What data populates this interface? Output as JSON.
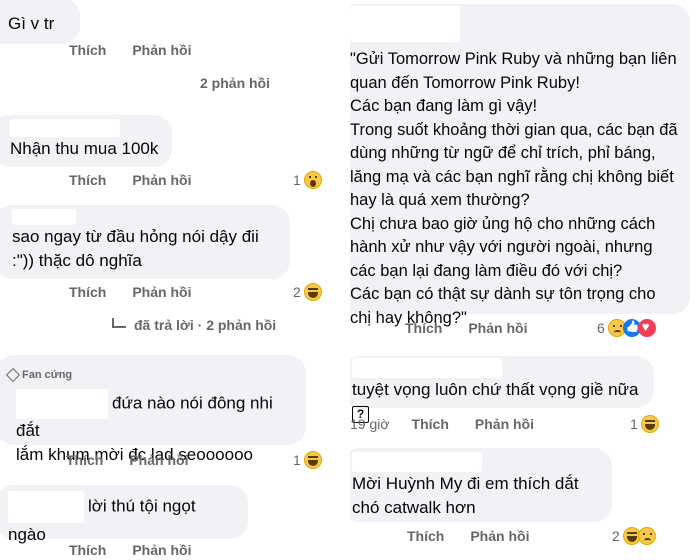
{
  "actions": {
    "like": "Thích",
    "reply": "Phản hồi"
  },
  "left": {
    "c1": {
      "text": "Gì v tr",
      "replies": "2 phản hồi"
    },
    "c2": {
      "text": "Nhận thu mua 100k",
      "react_count": "1"
    },
    "c3": {
      "text": "sao ngay từ đầu hỏng nói dậy đii :\")) thặc dô nghĩa",
      "react_count": "2",
      "replies": "đã trả lời · 2 phản hồi"
    },
    "c4": {
      "badge": "Fan cứng",
      "text_line1": "đứa nào nói đông nhi đắt",
      "text_line2": "lắm khum mời đc lad seoooooo",
      "react_count": "1"
    },
    "c5": {
      "text": "lời thú tội ngọt ngào"
    }
  },
  "right": {
    "c1": {
      "text": "\"Gửi Tomorrow Pink Ruby và những bạn liên quan đến Tomorrow Pink Ruby!\nCác bạn đang làm gì vậy!\nTrong suốt khoảng thời gian qua, các bạn đã dùng những từ ngữ để chỉ trích, phỉ báng, lăng mạ và các bạn nghĩ rằng chị không biết hay là quá xem thường?\nChị chưa bao giờ ủng hộ cho những cách hành xử như vậy với người ngoài, nhưng các bạn lại đang làm điều đó với chị?\nCác bạn có thật sự dành sự tôn trọng cho chị hay không?\"",
      "react_count": "6"
    },
    "c2": {
      "text": "tuyệt vọng luôn chứ thất vọng giề nữa",
      "box_glyph": "?",
      "time": "19 giờ",
      "react_count": "1"
    },
    "c3": {
      "text": "Mời Huỳnh My đi em thích dắt chó catwalk hơn",
      "react_count": "2"
    }
  }
}
